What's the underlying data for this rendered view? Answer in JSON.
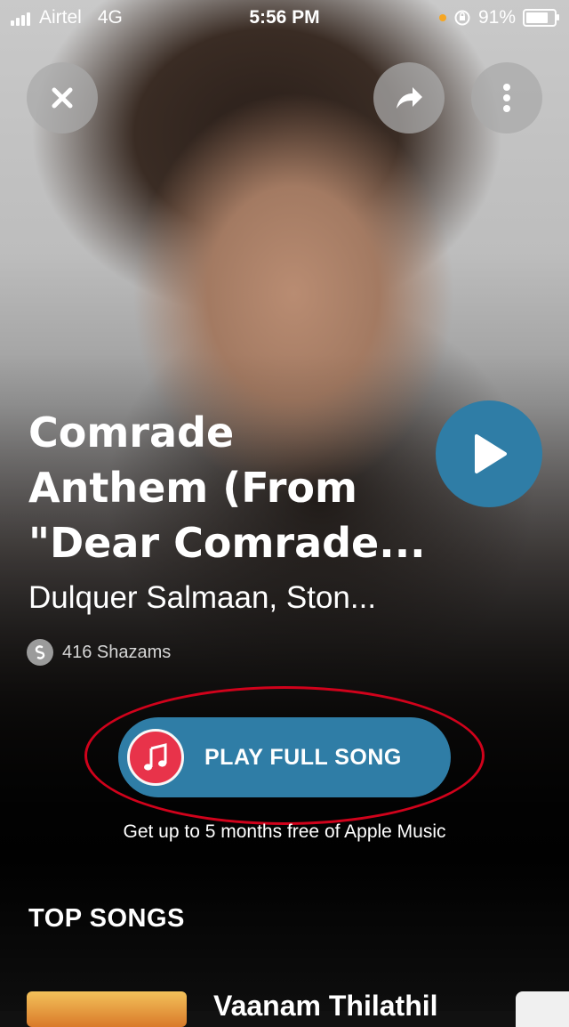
{
  "status_bar": {
    "carrier": "Airtel",
    "network": "4G",
    "time": "5:56 PM",
    "battery": "91%",
    "battery_level": 0.91
  },
  "top_actions": {
    "close_icon": "close-icon",
    "share_icon": "share-icon",
    "more_icon": "more-vertical-icon"
  },
  "track": {
    "title_line1": "Comrade",
    "title_line2": "Anthem (From",
    "title_line3": "\"Dear Comrade...",
    "artist": "Dulquer Salmaan, Ston...",
    "shazam_count": "416 Shazams"
  },
  "cta": {
    "label": "PLAY FULL SONG",
    "promo": "Get up to 5 months free of Apple Music"
  },
  "top_songs": {
    "heading": "TOP SONGS",
    "first_song_title": "Vaanam Thilathil"
  },
  "colors": {
    "accent": "#2f7da6",
    "apple_music": "#e8334a",
    "highlight": "#d0021b"
  }
}
